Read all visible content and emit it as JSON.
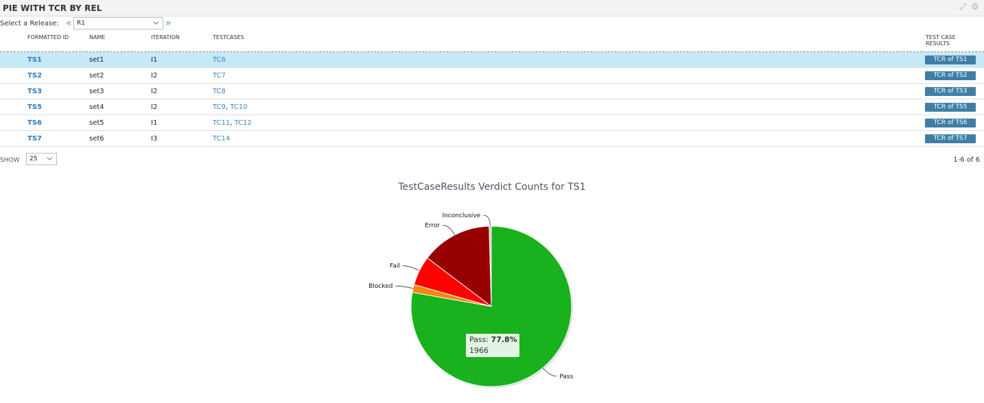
{
  "panel": {
    "title": "PIE WITH TCR BY REL"
  },
  "release": {
    "label": "Select a Release:",
    "prev": "«",
    "next": "»",
    "value": "R1"
  },
  "table": {
    "headers": {
      "formatted_id": "FORMATTED ID",
      "name": "NAME",
      "iteration": "ITERATION",
      "testcases": "TESTCASES",
      "results_line1": "TEST CASE",
      "results_line2": "RESULTS"
    },
    "rows": [
      {
        "id": "TS1",
        "name": "set1",
        "iteration": "I1",
        "testcases": [
          "TC6"
        ],
        "result": "TCR of TS1",
        "selected": true
      },
      {
        "id": "TS2",
        "name": "set2",
        "iteration": "I2",
        "testcases": [
          "TC7"
        ],
        "result": "TCR of TS2"
      },
      {
        "id": "TS3",
        "name": "set3",
        "iteration": "I2",
        "testcases": [
          "TC8"
        ],
        "result": "TCR of TS3"
      },
      {
        "id": "TS5",
        "name": "set4",
        "iteration": "I2",
        "testcases": [
          "TC9",
          "TC10"
        ],
        "result": "TCR of TS5"
      },
      {
        "id": "TS6",
        "name": "set5",
        "iteration": "I1",
        "testcases": [
          "TC11",
          "TC12"
        ],
        "result": "TCR of TS6"
      },
      {
        "id": "TS7",
        "name": "set6",
        "iteration": "I3",
        "testcases": [
          "TC14"
        ],
        "result": "TCR of TS7"
      }
    ]
  },
  "pager": {
    "show_label": "SHOW",
    "page_size": "25",
    "range": "1-6 of 6"
  },
  "chart_data": {
    "type": "pie",
    "title": "TestCaseResults Verdict Counts for TS1",
    "slices": [
      {
        "name": "Pass",
        "value": 1966,
        "color": "#19b11e"
      },
      {
        "name": "Blocked",
        "value": 40,
        "color": "#f5870c"
      },
      {
        "name": "Fail",
        "value": 150,
        "color": "#fd0000"
      },
      {
        "name": "Error",
        "value": 360,
        "color": "#970000"
      },
      {
        "name": "Inconclusive",
        "value": 11,
        "color": "#c8c8c8"
      }
    ],
    "tooltip": {
      "series": "Pass",
      "percent": "77.8%",
      "value": "1966"
    }
  }
}
